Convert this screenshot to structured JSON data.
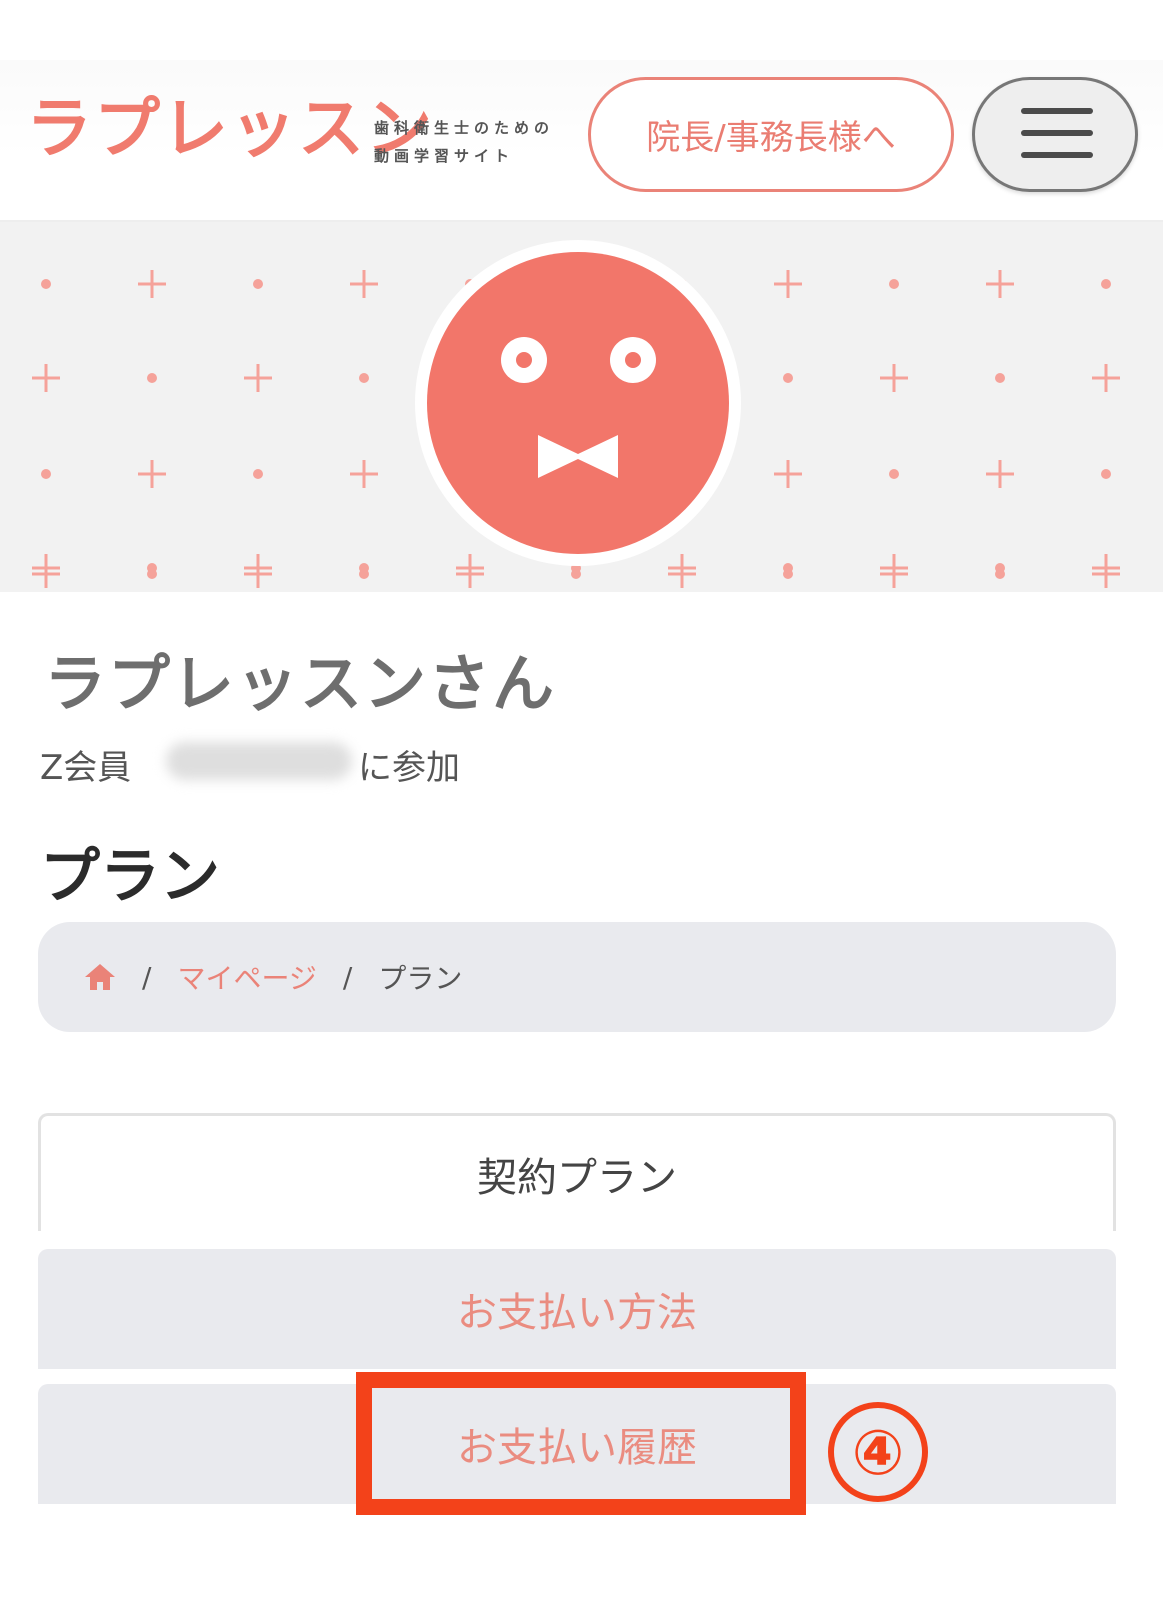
{
  "header": {
    "logo_text": "ラプレッスン",
    "tagline_line1": "歯科衛生士のための",
    "tagline_line2": "動画学習サイト",
    "director_button_label": "院長/事務長様へ"
  },
  "profile": {
    "name": "ラプレッスンさん",
    "membership": "Z会員",
    "joined_suffix": "に参加"
  },
  "page": {
    "title": "プラン"
  },
  "breadcrumb": {
    "separator": "/",
    "mypage": "マイページ",
    "current": "プラン"
  },
  "tabs": {
    "contract_plan": "契約プラン",
    "payment_method": "お支払い方法",
    "payment_history": "お支払い履歴"
  },
  "annotation": {
    "step_number": "④"
  },
  "colors": {
    "brand": "#f07b6e",
    "avatar": "#f2766a",
    "highlight": "#f3421a"
  }
}
